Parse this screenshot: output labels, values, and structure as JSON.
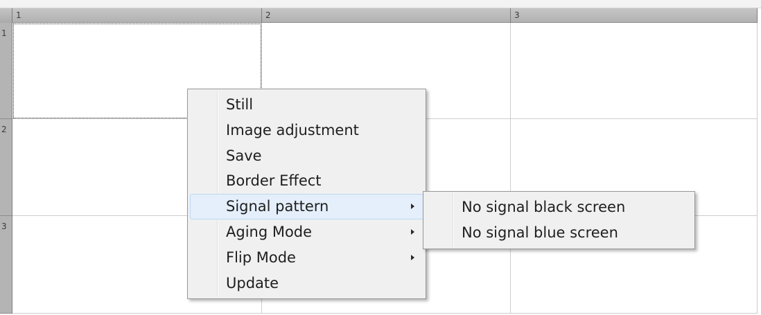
{
  "grid": {
    "columns": [
      "1",
      "2",
      "3"
    ],
    "rows": [
      "1",
      "2",
      "3"
    ],
    "selected_cell": {
      "row": 1,
      "column": 1
    }
  },
  "context_menu": {
    "items": [
      {
        "label": "Still",
        "has_submenu": false,
        "highlighted": false
      },
      {
        "label": "Image adjustment",
        "has_submenu": false,
        "highlighted": false
      },
      {
        "label": "Save",
        "has_submenu": false,
        "highlighted": false
      },
      {
        "label": "Border Effect",
        "has_submenu": false,
        "highlighted": false
      },
      {
        "label": "Signal pattern",
        "has_submenu": true,
        "highlighted": true
      },
      {
        "label": "Aging Mode",
        "has_submenu": true,
        "highlighted": false
      },
      {
        "label": "Flip Mode",
        "has_submenu": true,
        "highlighted": false
      },
      {
        "label": "Update",
        "has_submenu": false,
        "highlighted": false
      }
    ]
  },
  "submenu": {
    "items": [
      {
        "label": "No signal black screen",
        "has_submenu": false,
        "highlighted": false
      },
      {
        "label": "No signal blue screen",
        "has_submenu": false,
        "highlighted": false
      }
    ]
  },
  "icons": {
    "submenu_arrow": "chevron-right-icon"
  },
  "colors": {
    "menu_background": "#f0f0f0",
    "highlight_background": "#e4effb",
    "highlight_border": "#bcd8f2",
    "grid_line": "#cdcdcd"
  }
}
